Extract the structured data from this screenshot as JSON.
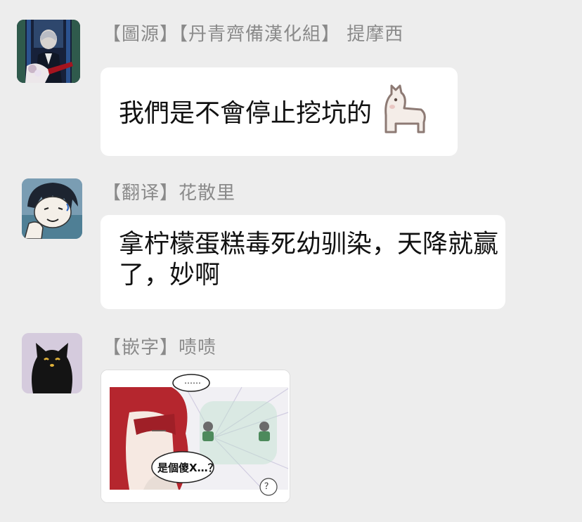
{
  "messages": [
    {
      "sender": "【圖源】【丹青齊備漢化組】 提摩西",
      "text": "我們是不會停止挖坑的",
      "sticker_icon": "alpaca-sticker-icon",
      "avatar_icon": "anime-portrait-avatar"
    },
    {
      "sender": "【翻译】花散里",
      "text": "拿柠檬蛋糕毒死幼驯染，天降就赢了，妙啊",
      "avatar_icon": "manga-boy-avatar"
    },
    {
      "sender": "【嵌字】啧啧",
      "avatar_icon": "black-cat-avatar",
      "image": {
        "speech_top": "……",
        "speech_main": "是個傻X…？",
        "speech_corner": "？"
      }
    }
  ],
  "colors": {
    "background": "#ededed",
    "bubble": "#ffffff",
    "sender_name": "#8a8a8a",
    "hair": "#b5262e"
  }
}
